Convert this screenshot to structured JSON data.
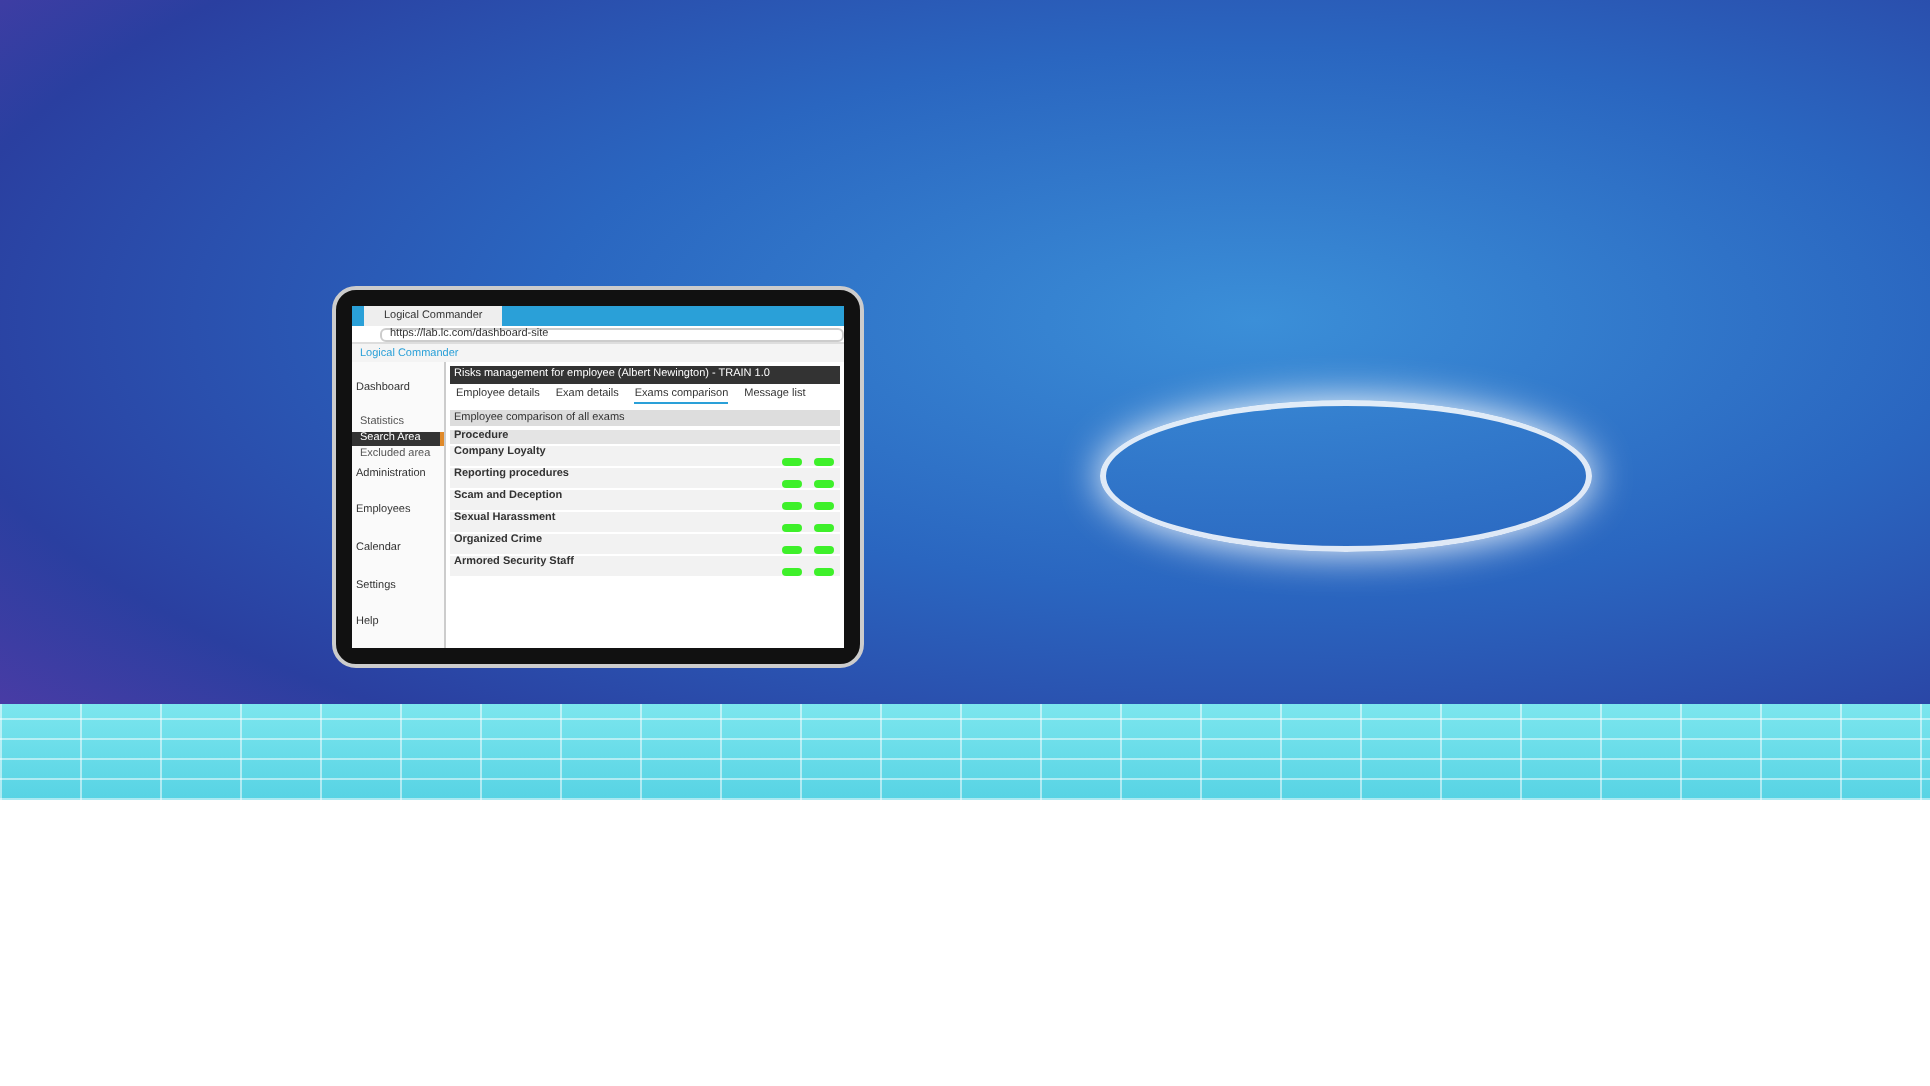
{
  "tablet": {
    "browser_tab": "Logical Commander",
    "url": "https://lab.lc.com/dashboard-site",
    "logo": "Logical Commander",
    "sidebar": [
      {
        "label": "Dashboard",
        "kind": "main",
        "selected": false
      },
      {
        "label": "Statistics",
        "kind": "sub",
        "selected": false
      },
      {
        "label": "Search Area",
        "kind": "sub",
        "selected": true
      },
      {
        "label": "Excluded area",
        "kind": "sub",
        "selected": false
      },
      {
        "label": "Administration",
        "kind": "main",
        "selected": false
      },
      {
        "label": "Employees",
        "kind": "main",
        "selected": false
      },
      {
        "label": "Calendar",
        "kind": "main",
        "selected": false
      },
      {
        "label": "Settings",
        "kind": "main",
        "selected": false
      },
      {
        "label": "Help",
        "kind": "main",
        "selected": false
      }
    ],
    "page_title": "Risks management for employee (Albert Newington) - TRAIN 1.0",
    "tabs": [
      {
        "label": "Employee details",
        "selected": false
      },
      {
        "label": "Exam details",
        "selected": false
      },
      {
        "label": "Exams comparison",
        "selected": true
      },
      {
        "label": "Message list",
        "selected": false
      }
    ],
    "section_title": "Employee comparison of all exams",
    "column": "Procedure",
    "rows": [
      {
        "label": "Company Loyalty",
        "results": [
          {
            "color": "#3ef02a"
          },
          {
            "color": "#3ef02a"
          }
        ]
      },
      {
        "label": "Reporting procedures",
        "results": [
          {
            "color": "#3ef02a"
          },
          {
            "color": "#3ef02a"
          }
        ]
      },
      {
        "label": "Scam and Deception",
        "results": [
          {
            "color": "#3ef02a"
          },
          {
            "color": "#3ef02a"
          }
        ]
      },
      {
        "label": "Sexual Harassment",
        "results": [
          {
            "color": "#3ef02a"
          },
          {
            "color": "#3ef02a"
          }
        ]
      },
      {
        "label": "Organized Crime",
        "results": [
          {
            "color": "#3ef02a"
          },
          {
            "color": "#3ef02a"
          }
        ]
      },
      {
        "label": "Armored Security Staff",
        "results": [
          {
            "color": "#3ef02a"
          },
          {
            "color": "#3ef02a"
          }
        ]
      }
    ]
  }
}
